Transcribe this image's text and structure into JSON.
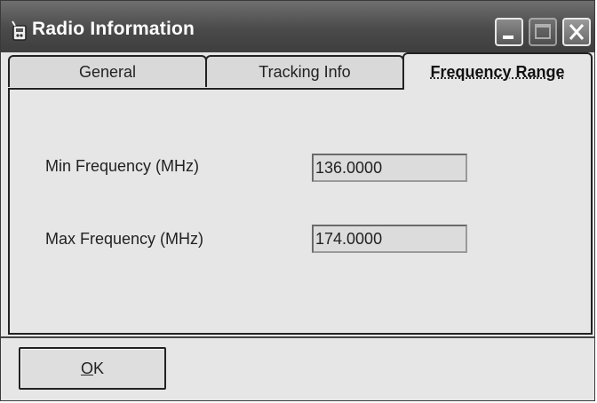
{
  "window": {
    "title": "Radio Information"
  },
  "tabs": [
    {
      "label": "General"
    },
    {
      "label": "Tracking Info"
    },
    {
      "label": "Frequency Range",
      "selected": true
    }
  ],
  "panel": {
    "min_label": "Min Frequency (MHz)",
    "min_value": "136.0000",
    "max_label": "Max Frequency (MHz)",
    "max_value": "174.0000"
  },
  "footer": {
    "ok_label_accel": "O",
    "ok_label_rest": "K"
  },
  "icons": {
    "app": "radio-icon",
    "minimize": "minimize-icon",
    "maximize": "maximize-icon",
    "close": "close-icon"
  }
}
